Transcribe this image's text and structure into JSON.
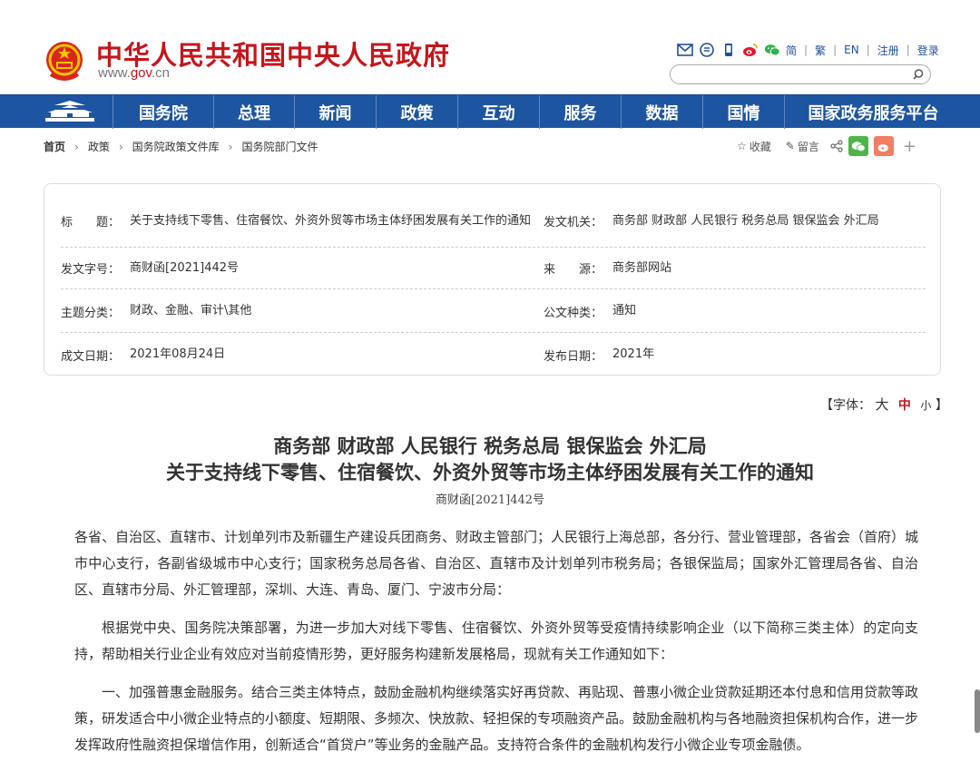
{
  "header": {
    "site_title": "中华人民共和国中央人民政府",
    "site_url_prefix": "www.",
    "site_url_brand": "gov",
    "site_url_suffix": ".cn",
    "lang_simplified": "简",
    "lang_traditional": "繁",
    "lang_en": "EN",
    "register": "注册",
    "login": "登录",
    "search_placeholder": ""
  },
  "nav": {
    "items": [
      "国务院",
      "总理",
      "新闻",
      "政策",
      "互动",
      "服务",
      "数据",
      "国情",
      "国家政务服务平台"
    ]
  },
  "breadcrumb": {
    "items": [
      "首页",
      "政策",
      "国务院政策文件库",
      "国务院部门文件"
    ]
  },
  "tools": {
    "favorite": "收藏",
    "comment": "留言"
  },
  "info": {
    "title_label": "标　　题：",
    "title_value": "关于支持线下零售、住宿餐饮、外资外贸等市场主体纾困发展有关工作的通知",
    "issuer_label": "发文机关：",
    "issuer_value": "商务部 财政部 人民银行 税务总局 银保监会 外汇局",
    "docno_label": "发文字号：",
    "docno_value": "商财函[2021]442号",
    "source_label": "来　　源：",
    "source_value": "商务部网站",
    "category_label": "主题分类：",
    "category_value": "财政、金融、审计\\其他",
    "doctype_label": "公文种类：",
    "doctype_value": "通知",
    "written_label": "成文日期：",
    "written_value": "2021年08月24日",
    "published_label": "发布日期：",
    "published_value": "2021年"
  },
  "font_size": {
    "prefix": "【字体：",
    "large": "大",
    "medium": "中",
    "small": "小",
    "suffix": "】"
  },
  "article": {
    "issuers": "商务部 财政部 人民银行 税务总局 银保监会 外汇局",
    "title": "关于支持线下零售、住宿餐饮、外资外贸等市场主体纾困发展有关工作的通知",
    "doc_number": "商财函[2021]442号",
    "paragraphs": [
      "各省、自治区、直辖市、计划单列市及新疆生产建设兵团商务、财政主管部门；人民银行上海总部，各分行、营业管理部，各省会（首府）城市中心支行，各副省级城市中心支行；国家税务总局各省、自治区、直辖市及计划单列市税务局；各银保监局；国家外汇管理局各省、自治区、直辖市分局、外汇管理部，深圳、大连、青岛、厦门、宁波市分局：",
      "根据党中央、国务院决策部署，为进一步加大对线下零售、住宿餐饮、外资外贸等受疫情持续影响企业（以下简称三类主体）的定向支持，帮助相关行业企业有效应对当前疫情形势，更好服务构建新发展格局，现就有关工作通知如下：",
      "一、加强普惠金融服务。结合三类主体特点，鼓励金融机构继续落实好再贷款、再贴现、普惠小微企业贷款延期还本付息和信用贷款等政策，研发适合中小微企业特点的小额度、短期限、多频次、快放款、轻担保的专项融资产品。鼓励金融机构与各地融资担保机构合作，进一步发挥政府性融资担保增信作用，创新适合“首贷户”等业务的金融产品。支持符合条件的金融机构发行小微企业专项金融债。"
    ]
  },
  "colors": {
    "brand_red": "#c4161c",
    "nav_blue": "#1e55a0",
    "link_blue": "#1f4f9c"
  }
}
